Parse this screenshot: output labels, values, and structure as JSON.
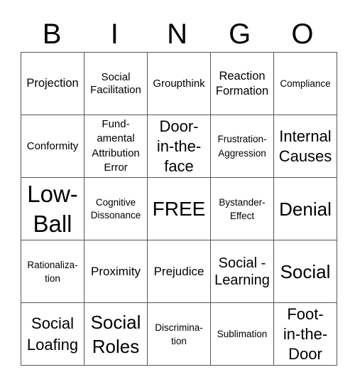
{
  "header": {
    "letters": [
      "B",
      "I",
      "N",
      "G",
      "O"
    ]
  },
  "grid": {
    "rows": [
      [
        "Projection",
        "Social\nFacilitation",
        "Groupthink",
        "Reaction\nFormation",
        "Compliance"
      ],
      [
        "Conformity",
        "Fund-\namental\nAttribution\nError",
        "Door-\nin-the-\nface",
        "Frustration-\nAggression",
        "Internal\nCauses"
      ],
      [
        "Low-\nBall",
        "Cognitive\nDissonance",
        "FREE",
        "Bystander-\nEffect",
        "Denial"
      ],
      [
        "Rationaliza-\ntion",
        "Proximity",
        "Prejudice",
        "Social -\nLearning",
        "Social"
      ],
      [
        "Social\nLoafing",
        "Social\nRoles",
        "Discrimina-\ntion",
        "Sublimation",
        "Foot-\nin-the-\nDoor"
      ]
    ]
  }
}
